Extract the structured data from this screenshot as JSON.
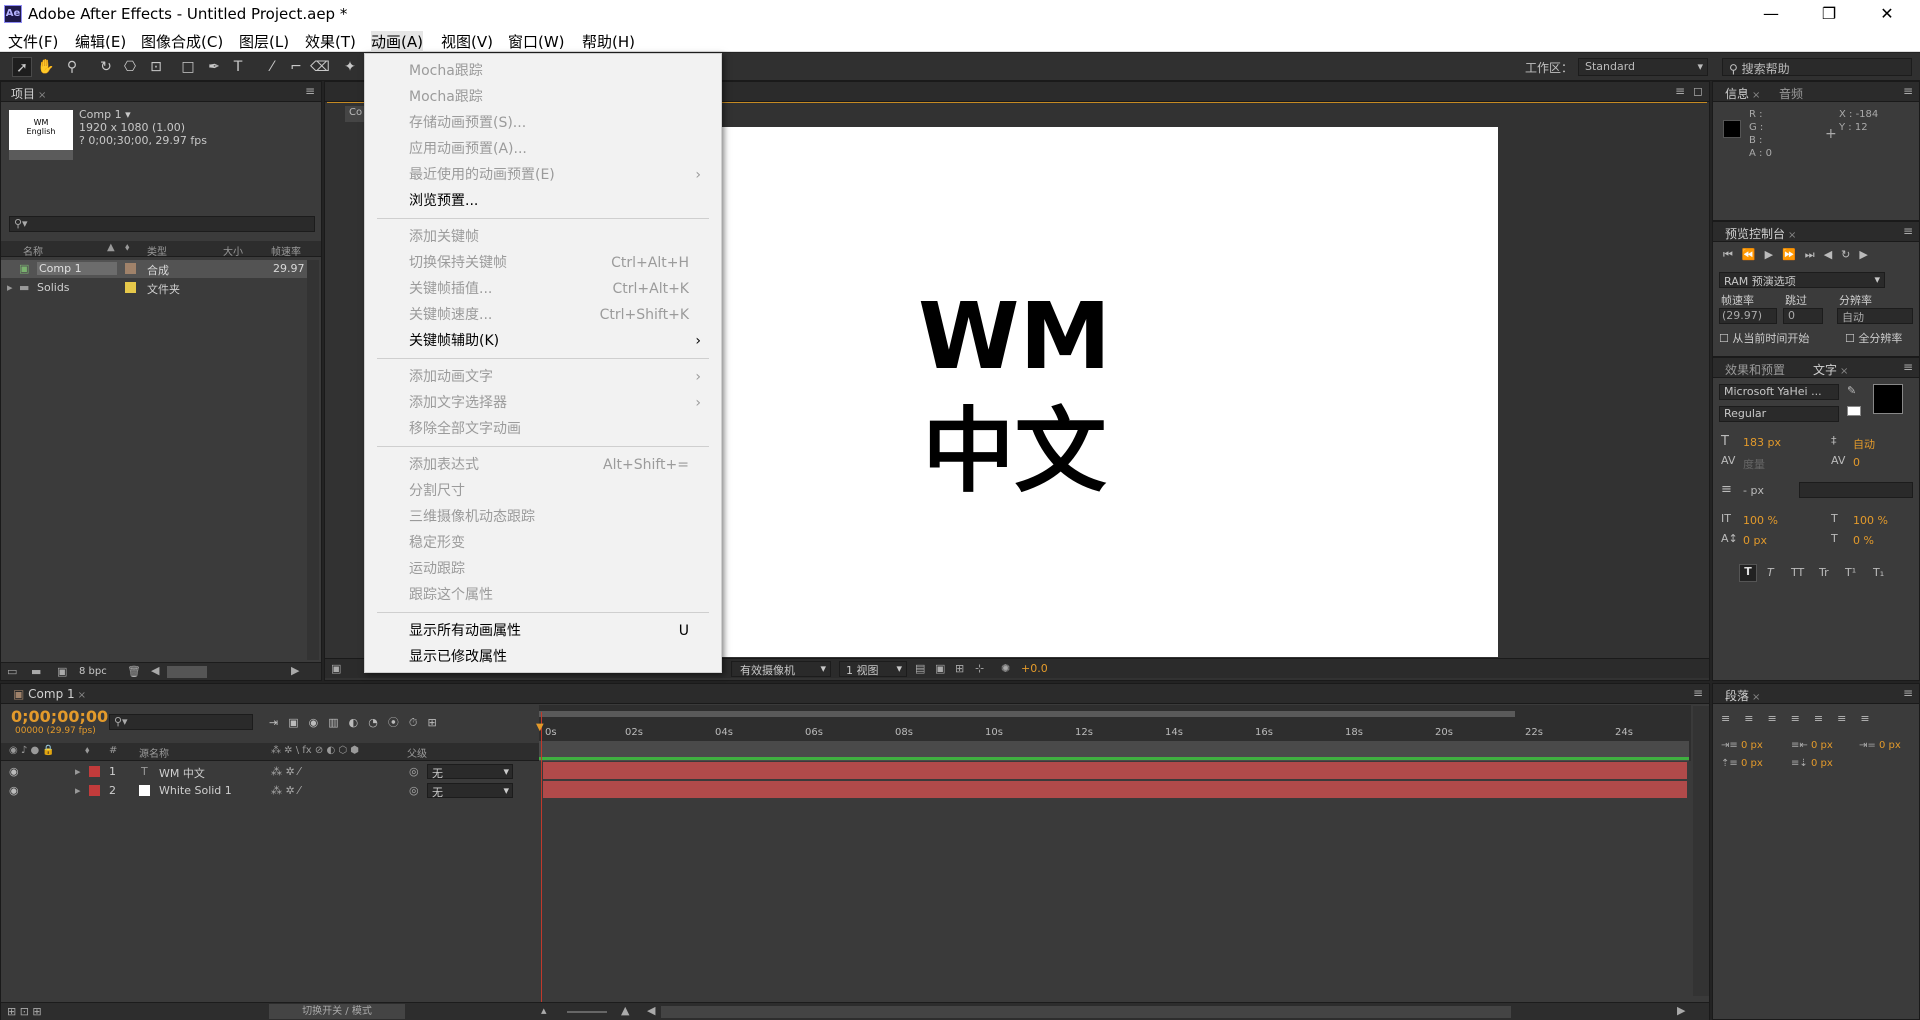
{
  "window": {
    "title": "Adobe After Effects - Untitled Project.aep *",
    "logo": "Ae"
  },
  "menubar": [
    "文件(F)",
    "编辑(E)",
    "图像合成(C)",
    "图层(L)",
    "效果(T)",
    "动画(A)",
    "视图(V)",
    "窗口(W)",
    "帮助(H)"
  ],
  "toolbar": {
    "workspace_label": "工作区：",
    "workspace_value": "Standard",
    "search_placeholder": "搜索帮助"
  },
  "project": {
    "tab": "项目",
    "comp_name": "Comp 1 ▾",
    "comp_size": "1920 x 1080 (1.00)",
    "comp_duration": "? 0;00;30;00, 29.97 fps",
    "thumb_text_1": "WM",
    "thumb_text_2": "English",
    "columns": [
      "名称",
      "类型",
      "大小",
      "帧速率"
    ],
    "items": [
      {
        "name": "Comp 1",
        "type": "合成",
        "size": "",
        "fps": "29.97",
        "color": "#a0826a"
      },
      {
        "name": "Solids",
        "type": "文件夹",
        "size": "",
        "fps": "",
        "color": "#e6c84a"
      }
    ],
    "bpc": "8 bpc"
  },
  "animation_menu": {
    "groups": [
      [
        {
          "label": "Mocha跟踪",
          "enabled": false
        },
        {
          "label": "Mocha跟踪",
          "enabled": false
        },
        {
          "label": "存储动画预置(S)...",
          "enabled": false
        },
        {
          "label": "应用动画预置(A)...",
          "enabled": false
        },
        {
          "label": "最近使用的动画预置(E)",
          "enabled": false,
          "submenu": true
        },
        {
          "label": "浏览预置...",
          "enabled": true
        }
      ],
      [
        {
          "label": "添加关键帧",
          "enabled": false
        },
        {
          "label": "切换保持关键帧",
          "enabled": false,
          "shortcut": "Ctrl+Alt+H"
        },
        {
          "label": "关键帧插值...",
          "enabled": false,
          "shortcut": "Ctrl+Alt+K"
        },
        {
          "label": "关键帧速度...",
          "enabled": false,
          "shortcut": "Ctrl+Shift+K"
        },
        {
          "label": "关键帧辅助(K)",
          "enabled": true,
          "submenu": true
        }
      ],
      [
        {
          "label": "添加动画文字",
          "enabled": false,
          "submenu": true
        },
        {
          "label": "添加文字选择器",
          "enabled": false,
          "submenu": true
        },
        {
          "label": "移除全部文字动画",
          "enabled": false
        }
      ],
      [
        {
          "label": "添加表达式",
          "enabled": false,
          "shortcut": "Alt+Shift+="
        },
        {
          "label": "分割尺寸",
          "enabled": false
        },
        {
          "label": "三维摄像机动态跟踪",
          "enabled": false
        },
        {
          "label": "稳定形变",
          "enabled": false
        },
        {
          "label": "运动跟踪",
          "enabled": false
        },
        {
          "label": "跟踪这个属性",
          "enabled": false
        }
      ],
      [
        {
          "label": "显示所有动画属性",
          "enabled": true,
          "shortcut": "U"
        },
        {
          "label": "显示已修改属性",
          "enabled": true
        }
      ]
    ]
  },
  "composition": {
    "text_line1": "WM",
    "text_line2": "中文",
    "footer": {
      "camera": "有效摄像机",
      "views": "1 视图",
      "exposure": "+0.0"
    }
  },
  "info": {
    "tabs": [
      "信息",
      "音频"
    ],
    "r": "R :",
    "g": "G :",
    "b": "B :",
    "a": "A : 0",
    "x": "X : -184",
    "y": "Y : 12"
  },
  "preview": {
    "tab": "预览控制台",
    "ram_label": "RAM 预演选项",
    "frame_rate_label": "帧速率",
    "skip_label": "跳过",
    "resolution_label": "分辨率",
    "frame_rate": "(29.97)",
    "skip": "0",
    "resolution": "自动",
    "from_current": "从当前时间开始",
    "full_screen": "全分辨率"
  },
  "character": {
    "tabs": [
      "效果和预置",
      "文字"
    ],
    "font": "Microsoft YaHei ...",
    "style": "Regular",
    "size": "183 px",
    "leading": "自动",
    "kerning": "度量",
    "tracking": "0",
    "stroke": "- px",
    "vscale": "100 %",
    "hscale": "100 %",
    "baseline": "0 px",
    "tsume": "0 %",
    "styles": [
      "T",
      "T",
      "TT",
      "Tr",
      "T¹",
      "T₁"
    ]
  },
  "paragraph": {
    "tab": "段落",
    "indent_left": "0 px",
    "indent_right": "0 px",
    "indent_first": "0 px",
    "space_before": "0 px",
    "space_after": "0 px"
  },
  "timeline": {
    "tab": "Comp 1",
    "timecode": "0;00;00;00",
    "frames": "00000 (29.97 fps)",
    "layer_col_name": "源名称",
    "parent_col": "父级",
    "ruler": [
      "0s",
      "02s",
      "04s",
      "06s",
      "08s",
      "10s",
      "12s",
      "14s",
      "16s",
      "18s",
      "20s",
      "22s",
      "24s"
    ],
    "layers": [
      {
        "num": "1",
        "name": "WM 中文",
        "parent": "无",
        "color": "#c23b3b"
      },
      {
        "num": "2",
        "name": "White Solid 1",
        "parent": "无",
        "color": "#c23b3b"
      }
    ],
    "footer_toggle": "切换开关 / 模式"
  }
}
